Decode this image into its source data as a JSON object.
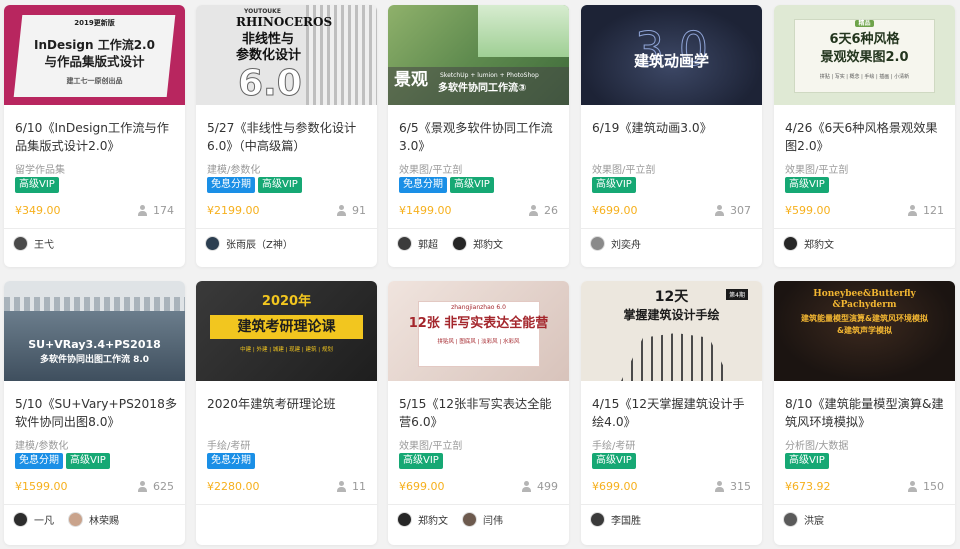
{
  "courses": [
    {
      "thumb": {
        "text": "2019更新版\nInDesign工作流2.0\n与作品集版式设计\n建工七一原创出品",
        "bg": "#b8265f",
        "fg": "#1f1f1f",
        "panel": "#f3f3f3"
      },
      "title": "6/10《InDesign工作流与作品集版式设计2.0》",
      "category": "留学作品集",
      "tags": [
        "高级VIP"
      ],
      "price": "¥349.00",
      "students": "174",
      "teachers": [
        "王弋"
      ]
    },
    {
      "thumb": {
        "text": "YOUTOUKE\nRHINOCEROS\n非线性与\n参数化设计\n6.0",
        "bg": "#e6e6e6",
        "fg": "#111111"
      },
      "title": "5/27《非线性与参数化设计6.0》（中高级篇）",
      "category": "建模/参数化",
      "tags": [
        "免息分期",
        "高级VIP"
      ],
      "price": "¥2199.00",
      "students": "91",
      "teachers": [
        "张雨辰（Z神）"
      ]
    },
    {
      "thumb": {
        "text": "景观\nSketchUp + lumion + PhotoShop\n多软件协同工作流③",
        "bg": "#5e8a4e",
        "fg": "#ffffff"
      },
      "title": "6/5《景观多软件协同工作流3.0》",
      "category": "效果图/平立剖",
      "tags": [
        "免息分期",
        "高级VIP"
      ],
      "price": "¥1499.00",
      "students": "26",
      "teachers": [
        "郭超",
        "郑豹文"
      ]
    },
    {
      "thumb": {
        "text": "3.0\n建筑动画学",
        "bg": "#1d2336",
        "fg": "#ffffff"
      },
      "title": "6/19《建筑动画3.0》",
      "category": "效果图/平立剖",
      "tags": [
        "高级VIP"
      ],
      "price": "¥699.00",
      "students": "307",
      "teachers": [
        "刘奕舟"
      ]
    },
    {
      "thumb": {
        "text": "精品\n6天6种风格\n景观效果图2.0\n拼贴 | 写实 | 概念 | 手绘 | 插画 | 小清新",
        "bg": "#dfe9d4",
        "fg": "#23351e"
      },
      "title": "4/26《6天6种风格景观效果图2.0》",
      "category": "效果图/平立剖",
      "tags": [
        "高级VIP"
      ],
      "price": "¥599.00",
      "students": "121",
      "teachers": [
        "郑豹文"
      ]
    },
    {
      "thumb": {
        "text": "SU+VRay3.4+PS2018\n多软件协同出图工作流 8.0",
        "bg": "#6b7d8c",
        "fg": "#ffffff"
      },
      "title": "5/10《SU+Vary+PS2018多软件协同出图8.0》",
      "category": "建模/参数化",
      "tags": [
        "免息分期",
        "高级VIP"
      ],
      "price": "¥1599.00",
      "students": "625",
      "teachers": [
        "一凡",
        "林荣赐"
      ]
    },
    {
      "thumb": {
        "text": "2020年\n建筑考研理论课\n中建 | 外建 | 城建 | 现建 | 建筑 | 规划",
        "bg": "#2a2a2a",
        "fg": "#f2c61f"
      },
      "title": "2020年建筑考研理论班",
      "category": "手绘/考研",
      "tags": [
        "免息分期"
      ],
      "price": "¥2280.00",
      "students": "11",
      "teachers": []
    },
    {
      "thumb": {
        "text": "zhangjianzhao 6.0\n12张 非写实表达全能营\n拼贴风 | 图底风 | 淡彩风 | 水彩风",
        "bg": "#e7d8d3",
        "fg": "#a4262c"
      },
      "title": "5/15《12张非写实表达全能营6.0》",
      "category": "效果图/平立剖",
      "tags": [
        "高级VIP"
      ],
      "price": "¥699.00",
      "students": "499",
      "teachers": [
        "郑豹文",
        "闫伟"
      ]
    },
    {
      "thumb": {
        "text": "12天\n掌握建筑设计手绘\n第4期",
        "bg": "#ece7de",
        "fg": "#1b1b1b"
      },
      "title": "4/15《12天掌握建筑设计手绘4.0》",
      "category": "手绘/考研",
      "tags": [
        "高级VIP"
      ],
      "price": "¥699.00",
      "students": "315",
      "teachers": [
        "李国胜"
      ]
    },
    {
      "thumb": {
        "text": "Honeybee&Butterfly\n&Pachyderm\n建筑能量模型演算&建筑风环境模拟\n&建筑声学模拟",
        "bg": "#1b1411",
        "fg": "#f2b632"
      },
      "title": "8/10《建筑能量模型演算&建筑风环境模拟》",
      "category": "分析图/大数据",
      "tags": [
        "高级VIP"
      ],
      "price": "¥673.92",
      "students": "150",
      "teachers": [
        "洪宸"
      ]
    }
  ]
}
